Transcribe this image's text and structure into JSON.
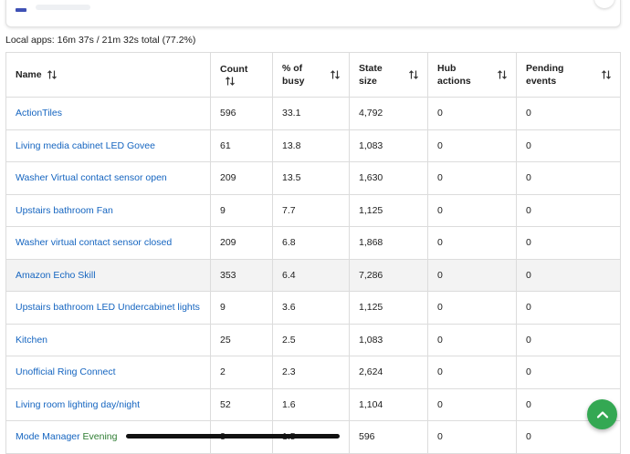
{
  "summary": "Local apps: 16m 37s / 21m 32s total (77.2%)",
  "columns": [
    {
      "label": "Name"
    },
    {
      "label": "Count"
    },
    {
      "label": "% of busy"
    },
    {
      "label": "State size"
    },
    {
      "label": "Hub actions"
    },
    {
      "label": "Pending events"
    }
  ],
  "rows": [
    {
      "name": "ActionTiles",
      "state": "",
      "count": "596",
      "busy": "33.1",
      "size": "4,792",
      "hub": "0",
      "pending": "0"
    },
    {
      "name": "Living media cabinet LED Govee",
      "state": "",
      "count": "61",
      "busy": "13.8",
      "size": "1,083",
      "hub": "0",
      "pending": "0"
    },
    {
      "name": "Washer Virtual contact sensor open",
      "state": "",
      "count": "209",
      "busy": "13.5",
      "size": "1,630",
      "hub": "0",
      "pending": "0"
    },
    {
      "name": "Upstairs bathroom Fan",
      "state": "",
      "count": "9",
      "busy": "7.7",
      "size": "1,125",
      "hub": "0",
      "pending": "0"
    },
    {
      "name": "Washer virtual contact sensor closed",
      "state": "",
      "count": "209",
      "busy": "6.8",
      "size": "1,868",
      "hub": "0",
      "pending": "0"
    },
    {
      "name": "Amazon Echo Skill",
      "state": "",
      "count": "353",
      "busy": "6.4",
      "size": "7,286",
      "hub": "0",
      "pending": "0"
    },
    {
      "name": "Upstairs bathroom LED Undercabinet lights",
      "state": "",
      "count": "9",
      "busy": "3.6",
      "size": "1,125",
      "hub": "0",
      "pending": "0"
    },
    {
      "name": "Kitchen",
      "state": "",
      "count": "25",
      "busy": "2.5",
      "size": "1,083",
      "hub": "0",
      "pending": "0"
    },
    {
      "name": "Unofficial Ring Connect",
      "state": "",
      "count": "2",
      "busy": "2.3",
      "size": "2,624",
      "hub": "0",
      "pending": "0"
    },
    {
      "name": "Living room lighting day/night",
      "state": "",
      "count": "52",
      "busy": "1.6",
      "size": "1,104",
      "hub": "0",
      "pending": "0"
    },
    {
      "name": "Mode Manager",
      "state": "Evening",
      "count": "3",
      "busy": "1.5",
      "size": "596",
      "hub": "0",
      "pending": "0"
    }
  ],
  "highlight_row": 5,
  "colors": {
    "link": "#1565c0",
    "state": "#2e7d32",
    "fab": "#34a853",
    "border": "#dcdcdc",
    "highlight": "#f3f3f3"
  },
  "icons": {
    "sort": "sort-arrows-icon",
    "fab": "chevron-up-icon"
  }
}
